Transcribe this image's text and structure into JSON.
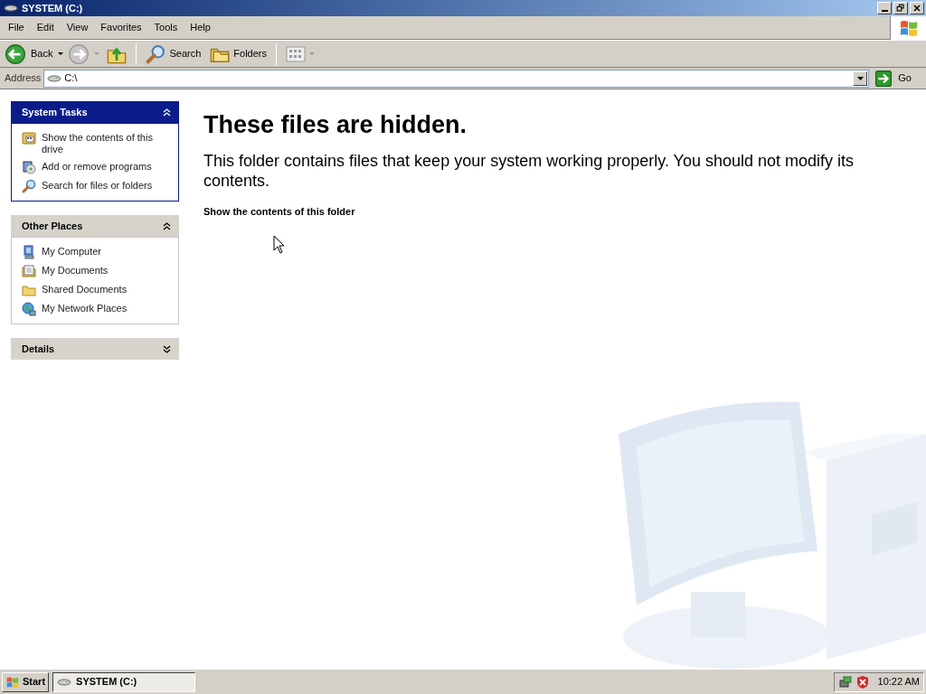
{
  "window": {
    "title": "SYSTEM (C:)"
  },
  "menu": [
    "File",
    "Edit",
    "View",
    "Favorites",
    "Tools",
    "Help"
  ],
  "toolbar": [
    {
      "kind": "back",
      "label": "Back",
      "disabled": false
    },
    {
      "kind": "forward",
      "disabled": true
    },
    {
      "kind": "up"
    },
    {
      "kind": "search",
      "label": "Search"
    },
    {
      "kind": "folders",
      "label": "Folders"
    },
    {
      "kind": "views"
    }
  ],
  "address": {
    "label": "Address",
    "value": "C:\\",
    "go": "Go"
  },
  "panels": [
    {
      "title": "System Tasks",
      "kind": "primary",
      "expanded": true,
      "items": [
        "Show the contents of this drive",
        "Add or remove programs",
        "Search for files or folders"
      ]
    },
    {
      "title": "Other Places",
      "kind": "normal",
      "expanded": true,
      "items": [
        "My Computer",
        "My Documents",
        "Shared Documents",
        "My Network Places"
      ]
    },
    {
      "title": "Details",
      "kind": "normal",
      "expanded": false
    }
  ],
  "content": {
    "heading": "These files are hidden.",
    "message": "This folder contains files that keep your system working properly. You should not modify its contents.",
    "link": "Show the contents of this folder"
  },
  "taskbar": {
    "start": "Start",
    "tasks": [
      {
        "label": "SYSTEM (C:)",
        "selected": true
      }
    ],
    "clock": "10:22 AM"
  }
}
